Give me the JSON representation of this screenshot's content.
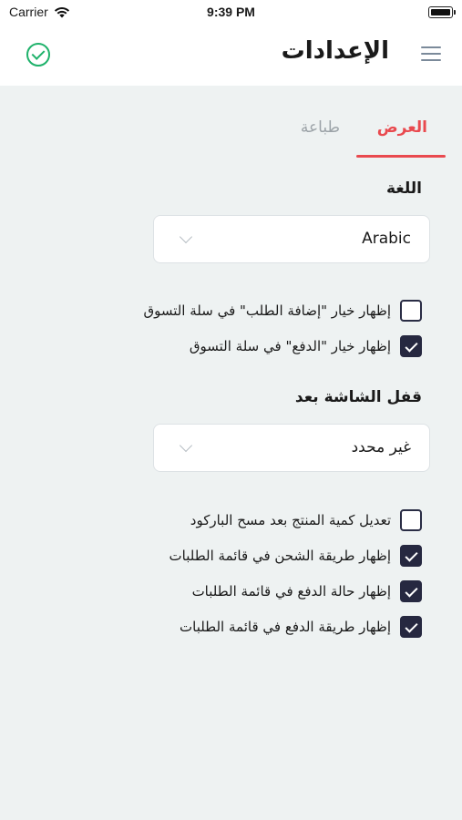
{
  "status_bar": {
    "carrier": "Carrier",
    "time": "9:39 PM"
  },
  "header": {
    "title": "الإعدادات"
  },
  "tabs": [
    {
      "label": "العرض",
      "active": true
    },
    {
      "label": "طباعة",
      "active": false
    }
  ],
  "language": {
    "label": "اللغة",
    "value": "Arabic"
  },
  "cart_options": [
    {
      "label": "إظهار خيار \"إضافة الطلب\" في سلة التسوق",
      "checked": false
    },
    {
      "label": "إظهار خيار \"الدفع\" في سلة التسوق",
      "checked": true
    }
  ],
  "screen_lock": {
    "label": "قفل الشاشة بعد",
    "value": "غير محدد"
  },
  "list_options": [
    {
      "label": "تعديل كمية المنتج بعد مسح الباركود",
      "checked": false
    },
    {
      "label": "إظهار طريقة الشحن في قائمة الطلبات",
      "checked": true
    },
    {
      "label": "إظهار حالة الدفع في قائمة الطلبات",
      "checked": true
    },
    {
      "label": "إظهار طريقة الدفع في قائمة الطلبات",
      "checked": true
    }
  ],
  "colors": {
    "accent": "#e94a4f",
    "check": "#1fb26b",
    "checkbox": "#262840",
    "background": "#eef2f2"
  },
  "icons": {
    "save": "check-circle-icon",
    "menu": "hamburger-menu-icon",
    "dropdown": "chevron-down-icon"
  }
}
